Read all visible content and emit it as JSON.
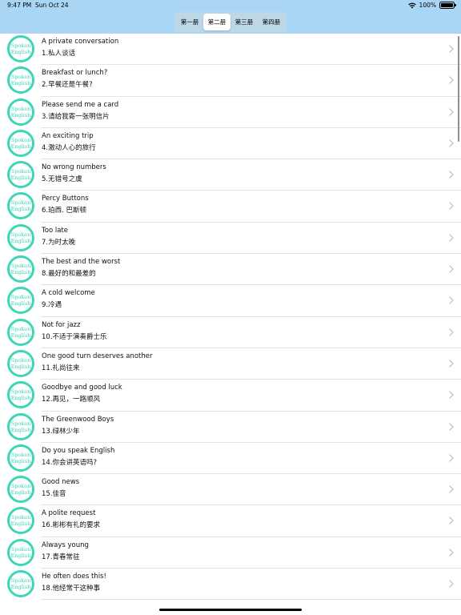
{
  "status_bar": {
    "time": "9:47 PM",
    "date": "Sun Oct 24",
    "battery": "100%",
    "battery_level": 1.0
  },
  "segments": [
    {
      "label": "第一册"
    },
    {
      "label": "第二册"
    },
    {
      "label": "第三册"
    },
    {
      "label": "第四册"
    }
  ],
  "active_segment": 1,
  "lessons": [
    {
      "title": "A private conversation",
      "subtitle": "1.私人谈话"
    },
    {
      "title": "Breakfast or lunch?",
      "subtitle": "2.早餐还是午餐?"
    },
    {
      "title": "Please send me a card",
      "subtitle": "3.请给我寄一张明信片"
    },
    {
      "title": "An exciting trip",
      "subtitle": "4.激动人心的旅行"
    },
    {
      "title": "No wrong numbers",
      "subtitle": "5.无错号之虞"
    },
    {
      "title": "Percy Buttons",
      "subtitle": "6.珀西. 巴斯顿"
    },
    {
      "title": "Too late",
      "subtitle": "7.为时太晚"
    },
    {
      "title": "The best and the worst",
      "subtitle": "8.最好的和最差的"
    },
    {
      "title": "A cold welcome",
      "subtitle": "9.冷遇"
    },
    {
      "title": "Not for jazz",
      "subtitle": "10.不适于演奏爵士乐"
    },
    {
      "title": "One good turn deserves another",
      "subtitle": "11.礼尚往来"
    },
    {
      "title": "Goodbye and good luck",
      "subtitle": "12.再见，一路顺风"
    },
    {
      "title": "The Greenwood Boys",
      "subtitle": "13.绿林少年"
    },
    {
      "title": "Do you speak English",
      "subtitle": "14.你会讲英语吗?"
    },
    {
      "title": "Good news",
      "subtitle": "15.佳音"
    },
    {
      "title": "A polite request",
      "subtitle": "16.彬彬有礼的要求"
    },
    {
      "title": "Always young",
      "subtitle": "17.青春常驻"
    },
    {
      "title": "He often does this!",
      "subtitle": "18.他经常干这种事"
    }
  ],
  "logo": {
    "line1": "Spoken",
    "line2": "English",
    "color": "#3dd7b7"
  },
  "colors": {
    "header": "#a9d6f4",
    "chevron": "#c4c4c7"
  },
  "icons": {
    "wifi": "wifi-icon",
    "battery": "battery-icon",
    "chevron": "chevron-right-icon"
  }
}
